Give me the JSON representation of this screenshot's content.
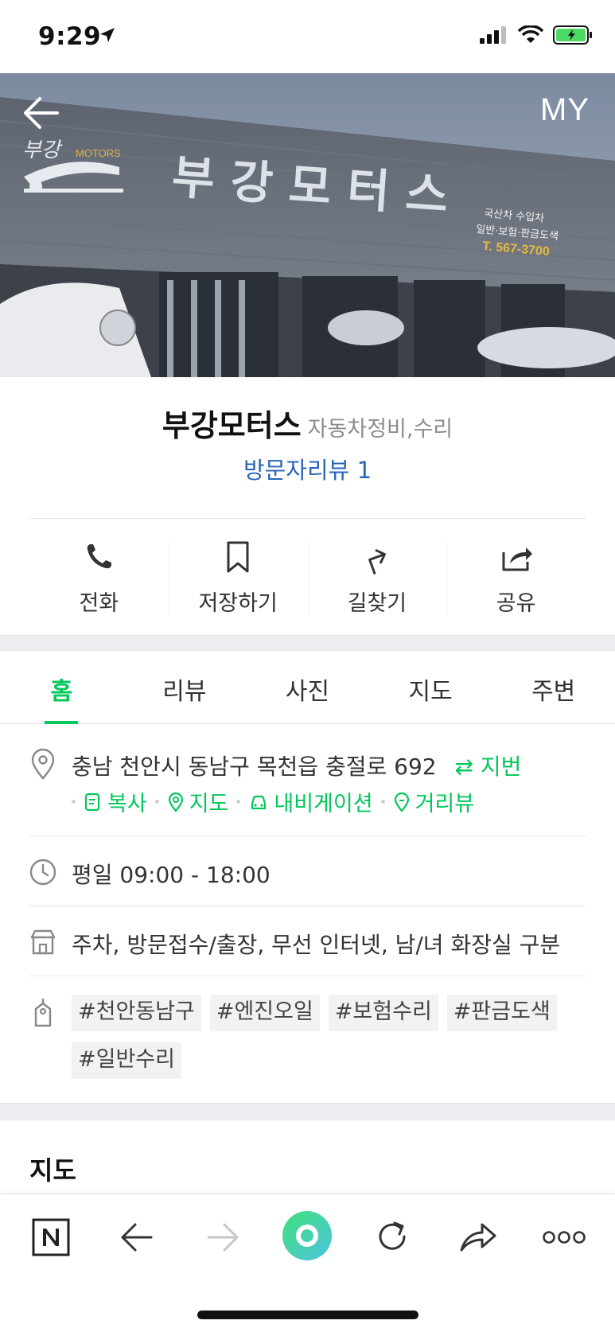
{
  "status": {
    "time": "9:29"
  },
  "hero": {
    "my_label": "MY"
  },
  "place": {
    "name": "부강모터스",
    "category": "자동차정비,수리",
    "review_link": "방문자리뷰 1"
  },
  "actions": [
    {
      "label": "전화",
      "icon": "phone-icon"
    },
    {
      "label": "저장하기",
      "icon": "bookmark-icon"
    },
    {
      "label": "길찾기",
      "icon": "directions-icon"
    },
    {
      "label": "공유",
      "icon": "share-icon"
    }
  ],
  "tabs": [
    {
      "label": "홈",
      "active": true
    },
    {
      "label": "리뷰"
    },
    {
      "label": "사진"
    },
    {
      "label": "지도"
    },
    {
      "label": "주변"
    }
  ],
  "address": {
    "text": "충남 천안시 동남구 목천읍 충절로 692",
    "lot_label": "지번",
    "links": [
      "복사",
      "지도",
      "내비게이션",
      "거리뷰"
    ]
  },
  "hours": "평일 09:00 - 18:00",
  "facilities": "주차, 방문접수/출장, 무선 인터넷, 남/녀 화장실 구분",
  "tags": [
    "#천안동남구",
    "#엔진오일",
    "#보험수리",
    "#판금도색",
    "#일반수리"
  ],
  "map_section": {
    "heading": "지도"
  },
  "colors": {
    "accent": "#03c75a",
    "link": "#2a66b8"
  }
}
